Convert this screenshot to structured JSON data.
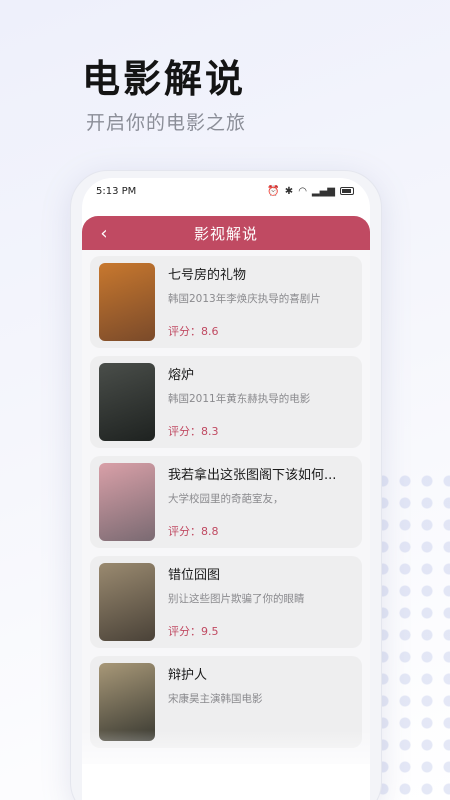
{
  "promo": {
    "title": "电影解说",
    "subtitle": "开启你的电影之旅"
  },
  "status_bar": {
    "time": "5:13 PM",
    "icons": [
      "alarm-icon",
      "bluetooth-icon",
      "wifi-icon",
      "signal-icon",
      "battery-icon"
    ]
  },
  "header": {
    "title": "影视解说",
    "back_icon": "chevron-left-icon",
    "color": "#c04a62"
  },
  "movies": [
    {
      "title": "七号房的礼物",
      "desc": "韩国2013年李焕庆执导的喜剧片",
      "rating": "评分：8.6",
      "poster_colors": [
        "#c8782e",
        "#7a4a2a"
      ]
    },
    {
      "title": "熔炉",
      "desc": "韩国2011年黄东赫执导的电影",
      "rating": "评分：8.3",
      "poster_colors": [
        "#4a4e4a",
        "#1e2220"
      ]
    },
    {
      "title": "我若拿出这张图阁下该如何...",
      "desc": "大学校园里的奇葩室友，",
      "rating": "评分：8.8",
      "poster_colors": [
        "#d9a0a8",
        "#7a6a72"
      ]
    },
    {
      "title": "错位囧图",
      "desc": "别让这些图片欺骗了你的眼睛",
      "rating": "评分：9.5",
      "poster_colors": [
        "#9a8a70",
        "#4a4238"
      ]
    },
    {
      "title": "辩护人",
      "desc": "宋康昊主演韩国电影",
      "rating": "",
      "poster_colors": [
        "#a89878",
        "#3a3a32"
      ]
    }
  ]
}
